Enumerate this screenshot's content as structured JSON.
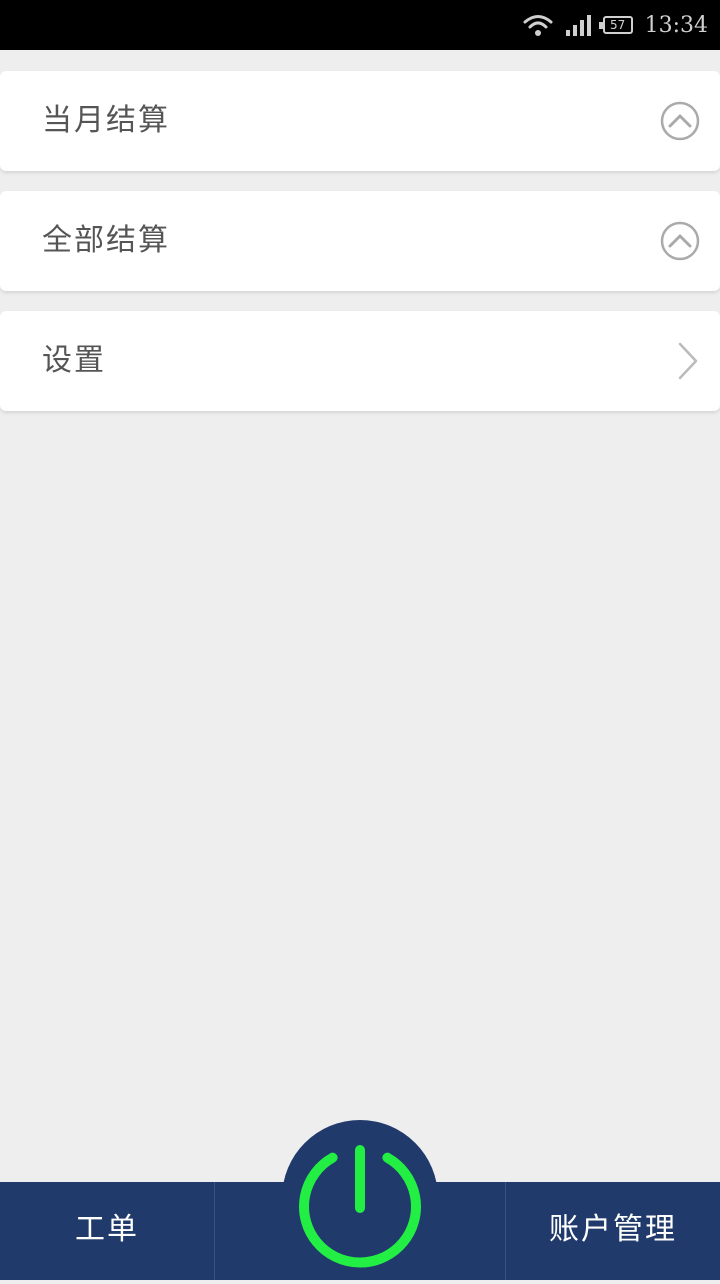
{
  "status_bar": {
    "battery": "57",
    "time": "13:34",
    "icons": [
      "wifi-icon",
      "signal-icon",
      "battery-icon"
    ]
  },
  "menu": [
    {
      "label": "当月结算",
      "icon": "chevron-up-circle-icon"
    },
    {
      "label": "全部结算",
      "icon": "chevron-up-circle-icon"
    },
    {
      "label": "设置",
      "icon": "chevron-right-icon"
    }
  ],
  "bottom_nav": {
    "left_tab": "工单",
    "right_tab": "账户管理",
    "center_icon": "power-icon"
  },
  "colors": {
    "background": "#eeeeee",
    "nav_bar": "#203b6b",
    "power_green": "#22ee44",
    "text": "#555555"
  }
}
